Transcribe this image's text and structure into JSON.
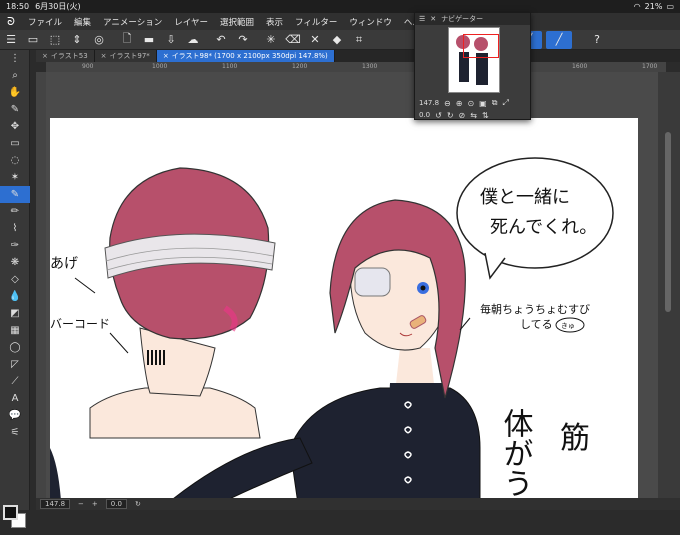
{
  "status": {
    "time": "18:50",
    "date": "6月30日(火)",
    "battery": "21%"
  },
  "menu": {
    "items": [
      "ファイル",
      "編集",
      "アニメーション",
      "レイヤー",
      "選択範囲",
      "表示",
      "フィルター",
      "ウィンドウ",
      "ヘルプ"
    ]
  },
  "tabs": [
    {
      "label": "イラスト53"
    },
    {
      "label": "イラスト97*"
    },
    {
      "label": "イラスト98* (1700 x 2100px 350dpi 147.8%)"
    }
  ],
  "ruler": {
    "ticks": [
      "900",
      "1000",
      "1100",
      "1200",
      "1300",
      "1400",
      "1500",
      "1600",
      "1700"
    ]
  },
  "navigator": {
    "title": "ナビゲーター",
    "zoom": "147.8",
    "angle": "0.0"
  },
  "bottom": {
    "zoom": "147.8",
    "angle": "0.0"
  },
  "annotations": {
    "speech1": "僕と一緒に",
    "speech2": "死んでくれ。",
    "side_label": "あげ",
    "barcode_label": "バーコード",
    "note1": "毎朝ちょうちょむすび",
    "note2": "してる",
    "note_badge": "きゅ",
    "vertical_text": "体がうす",
    "vertical_text2": "筋"
  },
  "colors": {
    "accent": "#2d6fd1",
    "hair": "#b7506b",
    "shirt": "#1e2230",
    "skin": "#fbe8dc"
  }
}
